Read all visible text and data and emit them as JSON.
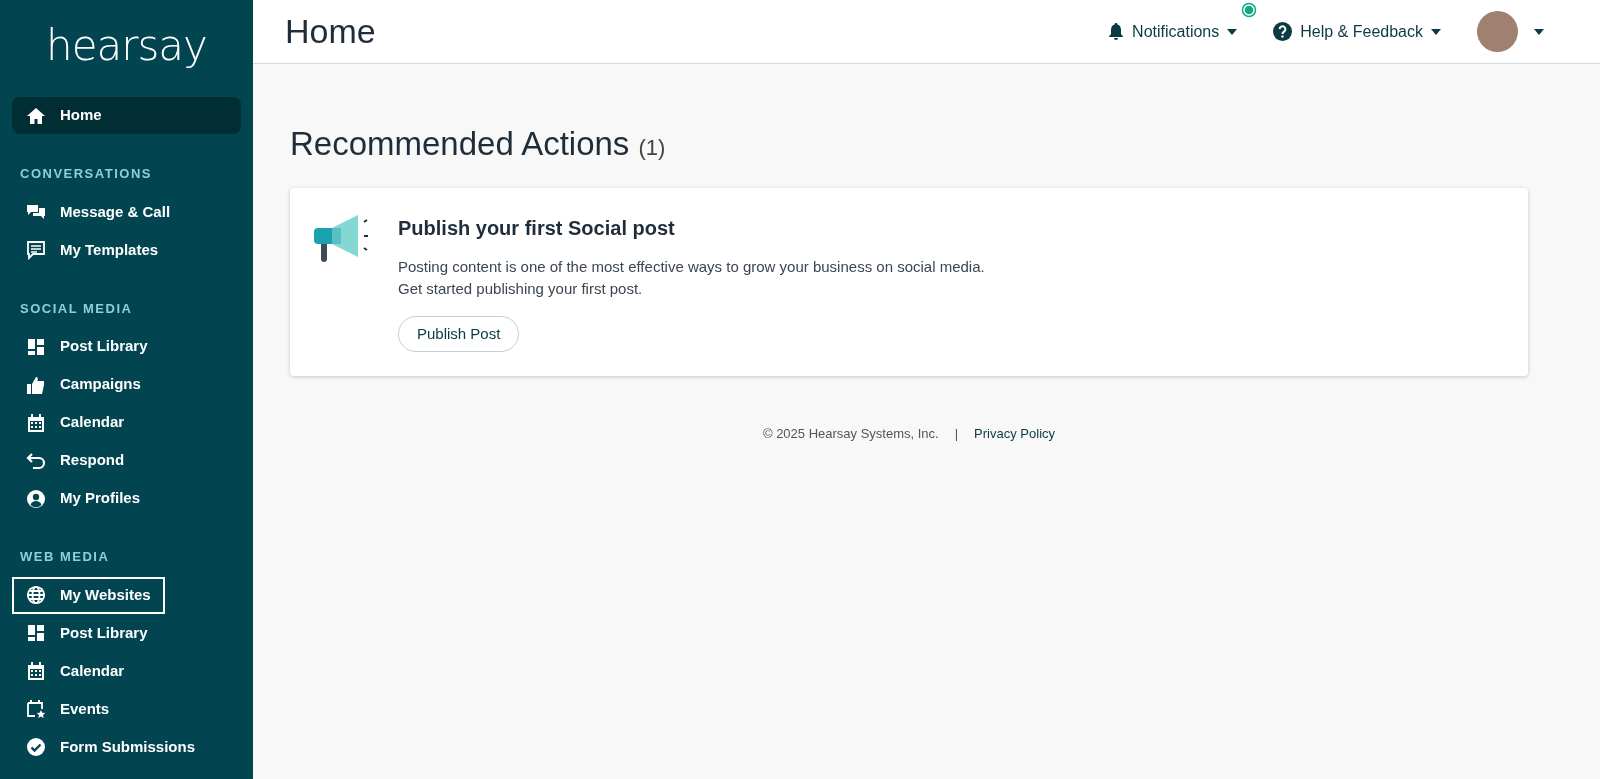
{
  "sidebar": {
    "logo": "hearsay",
    "sections": [
      {
        "items": [
          {
            "label": "Home",
            "selected": true,
            "focused": false
          }
        ]
      },
      {
        "heading": "CONVERSATIONS",
        "items": [
          {
            "label": "Message & Call",
            "selected": false,
            "focused": false
          },
          {
            "label": "My Templates",
            "selected": false,
            "focused": false
          }
        ]
      },
      {
        "heading": "SOCIAL MEDIA",
        "items": [
          {
            "label": "Post Library",
            "selected": false,
            "focused": false
          },
          {
            "label": "Campaigns",
            "selected": false,
            "focused": false
          },
          {
            "label": "Calendar",
            "selected": false,
            "focused": false
          },
          {
            "label": "Respond",
            "selected": false,
            "focused": false
          },
          {
            "label": "My Profiles",
            "selected": false,
            "focused": false
          }
        ]
      },
      {
        "heading": "WEB MEDIA",
        "items": [
          {
            "label": "My Websites",
            "selected": false,
            "focused": true
          },
          {
            "label": "Post Library",
            "selected": false,
            "focused": false
          },
          {
            "label": "Calendar",
            "selected": false,
            "focused": false
          },
          {
            "label": "Events",
            "selected": false,
            "focused": false
          },
          {
            "label": "Form Submissions",
            "selected": false,
            "focused": false
          }
        ]
      }
    ]
  },
  "header": {
    "title": "Home",
    "notifications": {
      "label": "Notifications",
      "has_new": true
    },
    "help": {
      "label": "Help & Feedback"
    }
  },
  "main": {
    "heading": "Recommended Actions",
    "count": "(1)",
    "cards": [
      {
        "title": "Publish your first Social post",
        "lines": [
          "Posting content is one of the most effective ways to grow your business on social media.",
          "Get started publishing your first post."
        ],
        "button": "Publish Post"
      }
    ]
  },
  "footer": {
    "copyright": "© 2025 Hearsay Systems, Inc.",
    "separator": "|",
    "link": "Privacy Policy"
  }
}
